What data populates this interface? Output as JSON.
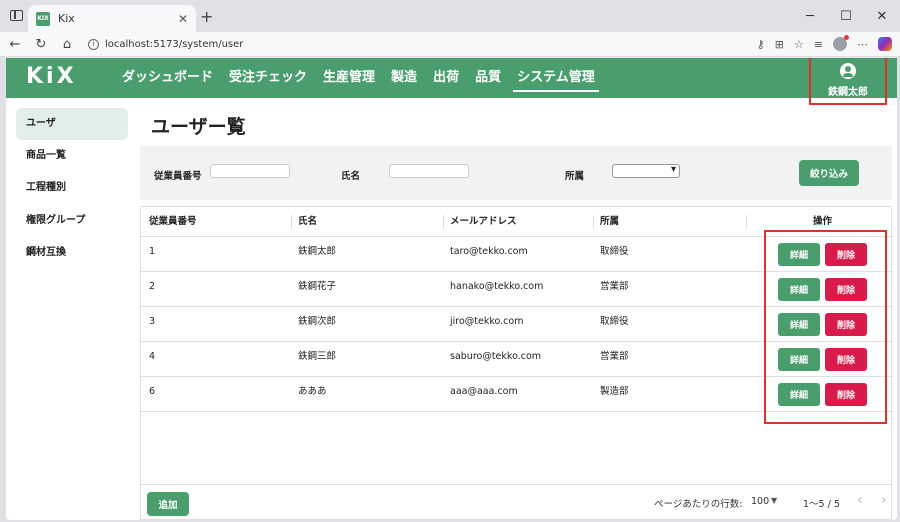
{
  "browser": {
    "tab_title": "Kix",
    "favicon_text": "KIX",
    "url": "localhost:5173/system/user"
  },
  "app": {
    "logo": "KiX",
    "menu": [
      {
        "label": "ダッシュボード"
      },
      {
        "label": "受注チェック"
      },
      {
        "label": "生産管理"
      },
      {
        "label": "製造"
      },
      {
        "label": "出荷"
      },
      {
        "label": "品質"
      },
      {
        "label": "システム管理",
        "active": true
      }
    ],
    "user_name": "鉄鋼太郎"
  },
  "sidebar": {
    "items": [
      {
        "label": "ユーザ",
        "active": true
      },
      {
        "label": "商品一覧"
      },
      {
        "label": "工程種別"
      },
      {
        "label": "権限グループ"
      },
      {
        "label": "鋼材互換"
      }
    ]
  },
  "page": {
    "title": "ユーザー覧"
  },
  "filter": {
    "employee_no_label": "従業員番号",
    "name_label": "氏名",
    "dept_label": "所属",
    "employee_no_value": "",
    "name_value": "",
    "dept_value": "",
    "button": "絞り込み"
  },
  "table": {
    "headers": [
      "従業員番号",
      "氏名",
      "メールアドレス",
      "所属",
      "操作"
    ],
    "rows": [
      {
        "id": "1",
        "name": "鉄鋼太郎",
        "email": "taro@tekko.com",
        "dept": "取締役"
      },
      {
        "id": "2",
        "name": "鉄鋼花子",
        "email": "hanako@tekko.com",
        "dept": "営業部"
      },
      {
        "id": "3",
        "name": "鉄鋼次郎",
        "email": "jiro@tekko.com",
        "dept": "取締役"
      },
      {
        "id": "4",
        "name": "鉄鋼三郎",
        "email": "saburo@tekko.com",
        "dept": "営業部"
      },
      {
        "id": "6",
        "name": "あああ",
        "email": "aaa@aaa.com",
        "dept": "製造部"
      }
    ],
    "detail_label": "詳細",
    "delete_label": "削除"
  },
  "footer": {
    "add_button": "追加",
    "rows_per_page_label": "ページあたりの行数:",
    "rows_per_page": "100",
    "range": "1～5 / 5"
  },
  "colors": {
    "primary": "#4a9e6e",
    "danger": "#d81b4a",
    "highlight": "#e03030"
  }
}
